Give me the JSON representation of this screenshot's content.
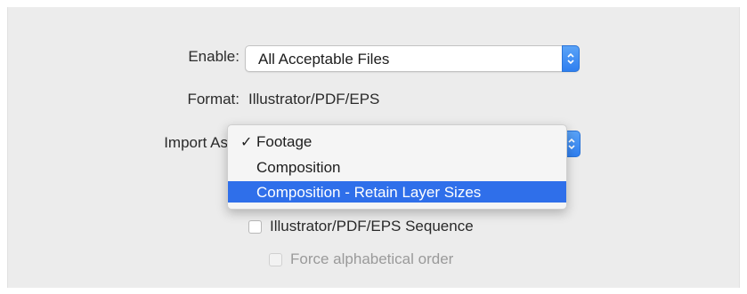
{
  "dialog": {
    "enable": {
      "label": "Enable:",
      "selected": "All Acceptable Files"
    },
    "format": {
      "label": "Format:",
      "value": "Illustrator/PDF/EPS"
    },
    "import_as": {
      "label": "Import As",
      "menu": {
        "checked_item": "Footage",
        "highlighted_item": "Composition - Retain Layer Sizes",
        "items": [
          {
            "label": "Footage",
            "checked": true,
            "highlighted": false
          },
          {
            "label": "Composition",
            "checked": false,
            "highlighted": false
          },
          {
            "label": "Composition - Retain Layer Sizes",
            "checked": false,
            "highlighted": true
          }
        ],
        "checkmark_glyph": "✓"
      }
    },
    "sequence_checkbox": {
      "label": "Illustrator/PDF/EPS Sequence",
      "checked": false,
      "enabled": true
    },
    "alpha_order_checkbox": {
      "label": "Force alphabetical order",
      "checked": false,
      "enabled": false
    }
  },
  "colors": {
    "panel_bg": "#ececec",
    "accent_blue": "#2f6fea",
    "stepper_blue": "#3b86f2"
  },
  "icons": {
    "stepper": "chevron-up-down-icon",
    "check": "checkmark-icon"
  }
}
